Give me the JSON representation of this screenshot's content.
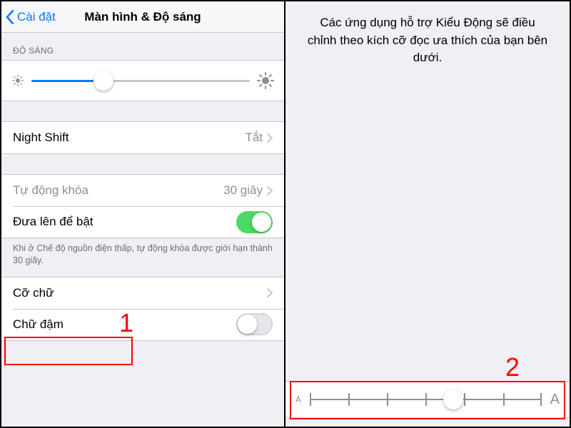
{
  "left": {
    "back_label": "Cài đặt",
    "title": "Màn hình & Độ sáng",
    "brightness_header": "ĐỘ SÁNG",
    "brightness_pct": 33,
    "rows": {
      "night_shift": {
        "label": "Night Shift",
        "value": "Tắt"
      },
      "auto_lock": {
        "label": "Tự động khóa",
        "value": "30 giây"
      },
      "raise_wake": {
        "label": "Đưa lên để bật"
      },
      "text_size": {
        "label": "Cỡ chữ"
      },
      "bold_text": {
        "label": "Chữ đậm"
      }
    },
    "auto_lock_note": "Khi ở Chế độ nguồn điện thấp, tự động khóa được giới hạn thành 30 giây."
  },
  "right": {
    "description": "Các ứng dụng hỗ trợ Kiểu Động sẽ điều chỉnh theo kích cỡ đọc ưa thích của bạn bên dưới.",
    "text_size_steps": 7,
    "text_size_index": 4
  },
  "annotations": {
    "one": "1",
    "two": "2"
  }
}
